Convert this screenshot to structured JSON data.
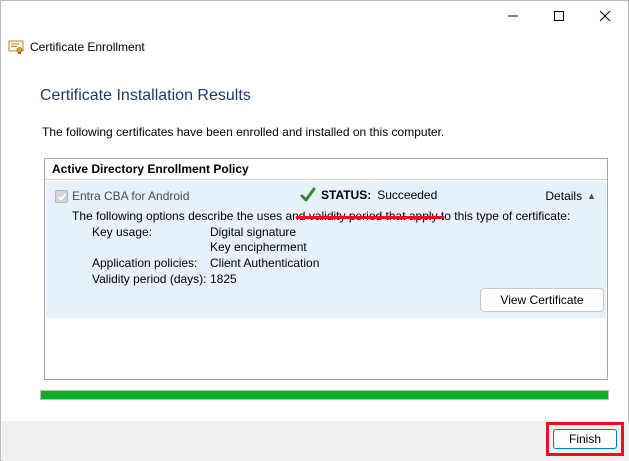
{
  "window": {
    "title": "Certificate Enrollment",
    "icons": {
      "minimize": "minimize-icon",
      "maximize": "maximize-icon",
      "close": "close-icon",
      "app": "certificate-icon"
    }
  },
  "page": {
    "heading": "Certificate Installation Results",
    "intro": "The following certificates have been enrolled and installed on this computer."
  },
  "policy": {
    "name": "Active Directory Enrollment Policy",
    "certificate": {
      "name": "Entra CBA for Android",
      "checked": true,
      "status_label": "STATUS:",
      "status_value": "Succeeded",
      "details_label": "Details",
      "description": "The following options describe the uses and validity period that apply to this type of certificate:",
      "key_usage_label": "Key usage:",
      "key_usage_values": [
        "Digital signature",
        "Key encipherment"
      ],
      "app_policies_label": "Application policies:",
      "app_policies_value": "Client Authentication",
      "validity_label": "Validity period (days):",
      "validity_value": "1825",
      "view_button": "View Certificate"
    }
  },
  "progress": {
    "value": 1.0,
    "color": "#06b025"
  },
  "footer": {
    "finish_label": "Finish"
  },
  "colors": {
    "heading": "#1f3b6e",
    "highlight": "#e81123",
    "panel": "#e6f1fa",
    "success": "#2e8b2e"
  }
}
